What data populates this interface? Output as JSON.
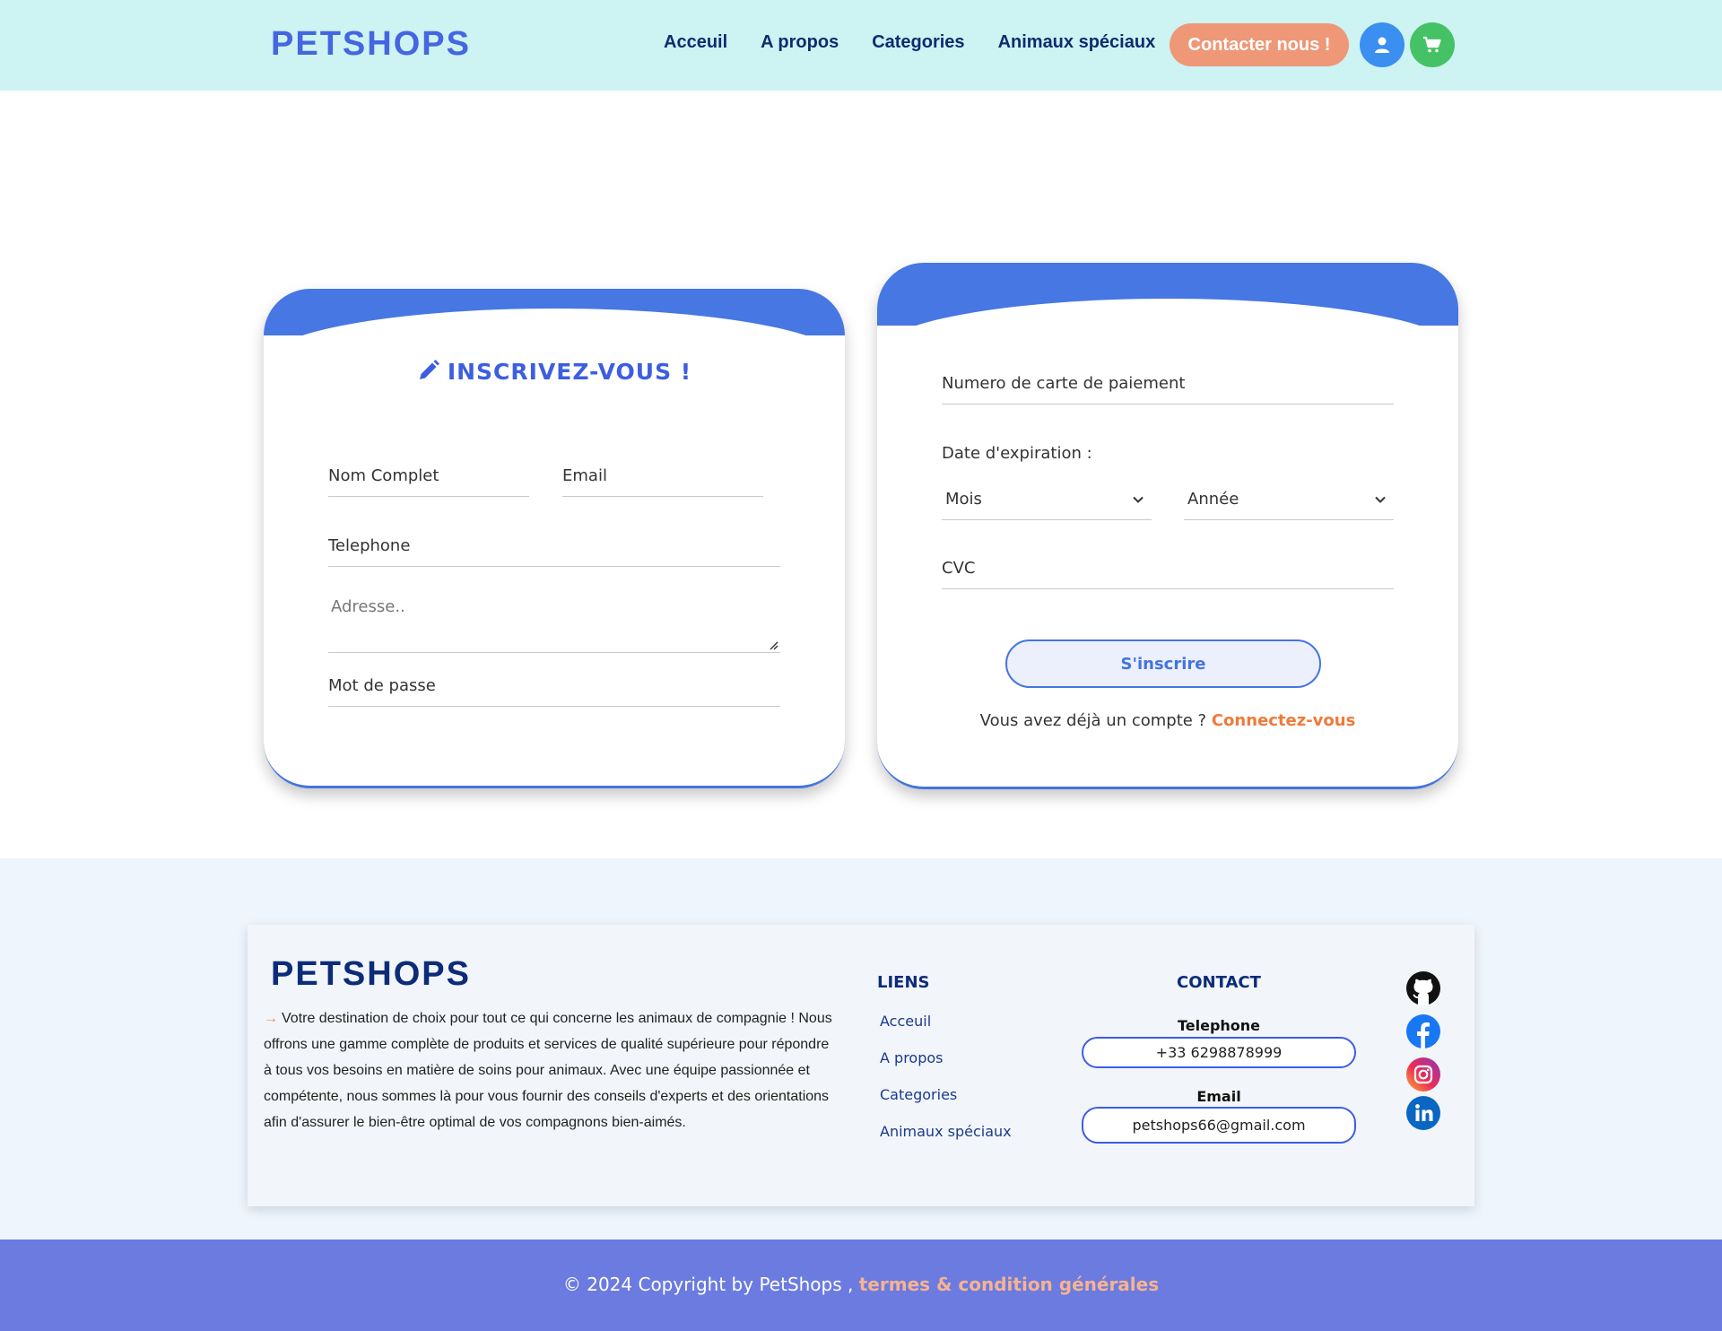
{
  "header": {
    "brand": "PETSHOPS",
    "nav": [
      "Acceuil",
      "A propos",
      "Categories",
      "Animaux spéciaux"
    ],
    "contact_button": "Contacter nous !",
    "icons": [
      "user-icon",
      "cart-icon"
    ]
  },
  "signup": {
    "title": "INSCRIVEZ-VOUS !",
    "title_icon": "pencil-icon",
    "full_name_placeholder": "Nom Complet",
    "email_placeholder": "Email",
    "phone_placeholder": "Telephone",
    "address_placeholder": "Adresse..",
    "password_placeholder": "Mot de passe"
  },
  "payment": {
    "card_number_placeholder": "Numero de carte de paiement",
    "expiry_label": "Date d'expiration :",
    "month_select": "Mois",
    "year_select": "Année",
    "cvc_placeholder": "CVC",
    "submit_button": "S'inscrire",
    "login_prompt": "Vous avez déjà un compte ?",
    "login_link": "Connectez-vous"
  },
  "footer": {
    "brand": "PETSHOPS",
    "description": "Votre destination de choix pour tout ce qui concerne les animaux de compagnie ! Nous offrons une gamme complète de produits et services de qualité supérieure pour répondre à tous vos besoins en matière de soins pour animaux. Avec une équipe passionnée et compétente, nous sommes là pour vous fournir des conseils d'experts et des orientations afin d'assurer le bien-être optimal de vos compagnons bien-aimés.",
    "links_heading": "LIENS",
    "links": [
      "Acceuil",
      "A propos",
      "Categories",
      "Animaux spéciaux"
    ],
    "contact_heading": "CONTACT",
    "phone_label": "Telephone",
    "phone_value": "+33 6298878999",
    "email_label": "Email",
    "email_value": "petshops66@gmail.com",
    "socials": [
      "github-icon",
      "facebook-icon",
      "instagram-icon",
      "linkedin-icon"
    ]
  },
  "copyright": {
    "text": "© 2024 Copyright by PetShops ,",
    "link": "termes & condition générales"
  },
  "colors": {
    "navbar_bg": "#cdf3f2",
    "brand_blue": "#4466e0",
    "contact_button": "#ee9878",
    "card_header": "#4677e3",
    "accent_orange": "#ef7a3a",
    "copyright_bar": "#6b7be0"
  }
}
